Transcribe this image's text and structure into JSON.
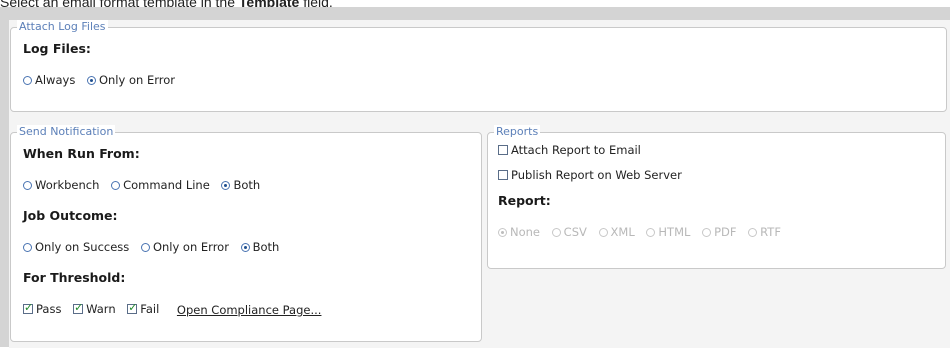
{
  "instruction": {
    "prefix": "Select an email format template in the ",
    "bold": "Template",
    "suffix": " field."
  },
  "attach_log": {
    "legend": "Attach Log Files",
    "heading": "Log Files:",
    "options": [
      {
        "label": "Always",
        "selected": false
      },
      {
        "label": "Only on Error",
        "selected": true
      }
    ]
  },
  "send_notification": {
    "legend": "Send Notification",
    "run_from": {
      "heading": "When Run From:",
      "options": [
        {
          "label": "Workbench",
          "selected": false
        },
        {
          "label": "Command Line",
          "selected": false
        },
        {
          "label": "Both",
          "selected": true
        }
      ]
    },
    "outcome": {
      "heading": "Job Outcome:",
      "options": [
        {
          "label": "Only on Success",
          "selected": false
        },
        {
          "label": "Only on Error",
          "selected": false
        },
        {
          "label": "Both",
          "selected": true
        }
      ]
    },
    "threshold": {
      "heading": "For Threshold:",
      "checks": [
        {
          "label": "Pass",
          "checked": true
        },
        {
          "label": "Warn",
          "checked": true
        },
        {
          "label": "Fail",
          "checked": true
        }
      ],
      "link": "Open Compliance Page..."
    }
  },
  "reports": {
    "legend": "Reports",
    "attach": {
      "label": "Attach Report to Email",
      "checked": false
    },
    "publish": {
      "label": "Publish Report on Web Server",
      "checked": false
    },
    "heading": "Report:",
    "formats": [
      {
        "label": "None",
        "selected": true
      },
      {
        "label": "CSV",
        "selected": false
      },
      {
        "label": "XML",
        "selected": false
      },
      {
        "label": "HTML",
        "selected": false
      },
      {
        "label": "PDF",
        "selected": false
      },
      {
        "label": "RTF",
        "selected": false
      }
    ]
  },
  "colors": {
    "legend": "#5b7fb8",
    "radio_border": "#4a74b2",
    "check_mark": "#1f8a2a",
    "disabled": "#b8b8b8"
  }
}
